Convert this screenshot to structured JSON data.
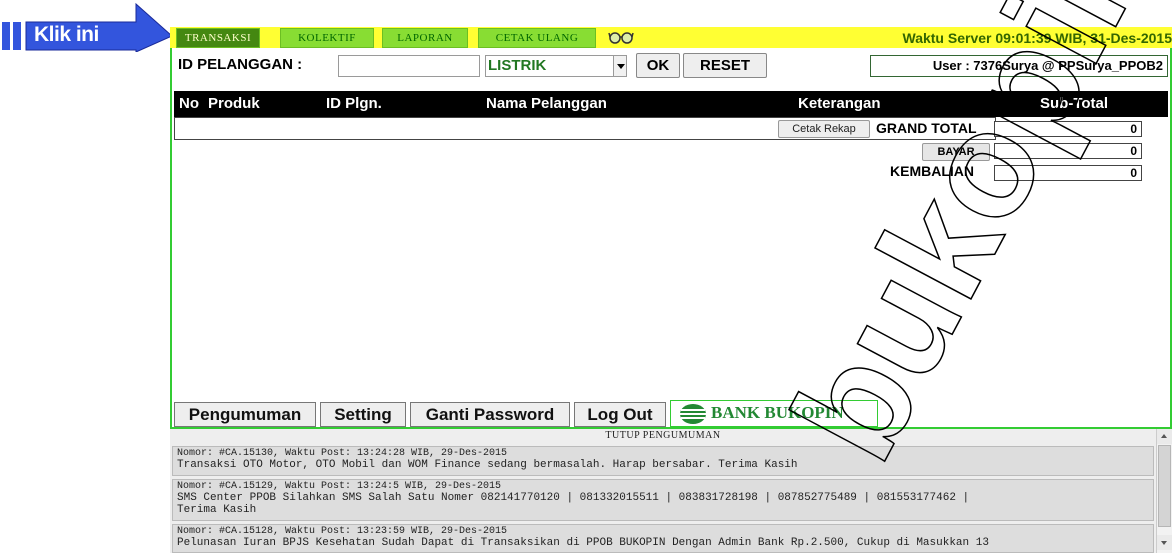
{
  "annotation": {
    "arrow_text": "Klik ini",
    "arrow_color": "#3355dd"
  },
  "tabs": [
    "TRANSAKSI",
    "KOLEKTIF",
    "LAPORAN",
    "CETAK ULANG"
  ],
  "header": {
    "server_time": "Waktu Server 09:01:39 WIB, 31-Des-2015",
    "bg_color": "#ffff33"
  },
  "form": {
    "id_label": "ID PELANGGAN :",
    "id_value": "",
    "product_selected": "LISTRIK",
    "ok_label": "OK",
    "reset_label": "RESET",
    "user": "User : 7376Surya @ PPSurya_PPOB2"
  },
  "table": {
    "columns": [
      "No",
      "Produk",
      "ID Plgn.",
      "Nama Pelanggan",
      "Keterangan",
      "Sub-Total"
    ],
    "cetak_rekap_label": "Cetak Rekap",
    "grand_total_label": "GRAND TOTAL",
    "grand_total_value": "0",
    "bayar_label": "BAYAR",
    "bayar_value": "0",
    "kembalian_label": "KEMBALIAN",
    "kembalian_value": "0"
  },
  "bottom_menu": {
    "items": [
      "Pengumuman",
      "Setting",
      "Ganti Password",
      "Log Out"
    ],
    "bank_name": "BANK BUKOPIN",
    "bank_color": "#228833"
  },
  "announcements": {
    "close_label": "TUTUP PENGUMUMAN",
    "items": [
      {
        "meta": "Nomor: #CA.15130, Waktu Post: 13:24:28 WIB, 29-Des-2015",
        "text": "Transaksi OTO Motor, OTO Mobil dan WOM Finance sedang bermasalah. Harap bersabar. Terima Kasih"
      },
      {
        "meta": "Nomor: #CA.15129, Waktu Post: 13:24:5 WIB, 29-Des-2015",
        "text": "SMS Center PPOB Silahkan SMS Salah Satu Nomer 082141770120 | 081332015511 | 083831728198 | 087852775489 | 081553177462 |",
        "text2": "Terima Kasih"
      },
      {
        "meta": "Nomor: #CA.15128, Waktu Post: 13:23:59 WIB, 29-Des-2015",
        "text": "Pelunasan Iuran BPJS Kesehatan Sudah Dapat di Transaksikan di PPOB BUKOPIN Dengan Admin Bank Rp.2.500, Cukup di Masukkan 13"
      }
    ]
  },
  "watermark_text": "bukopin"
}
